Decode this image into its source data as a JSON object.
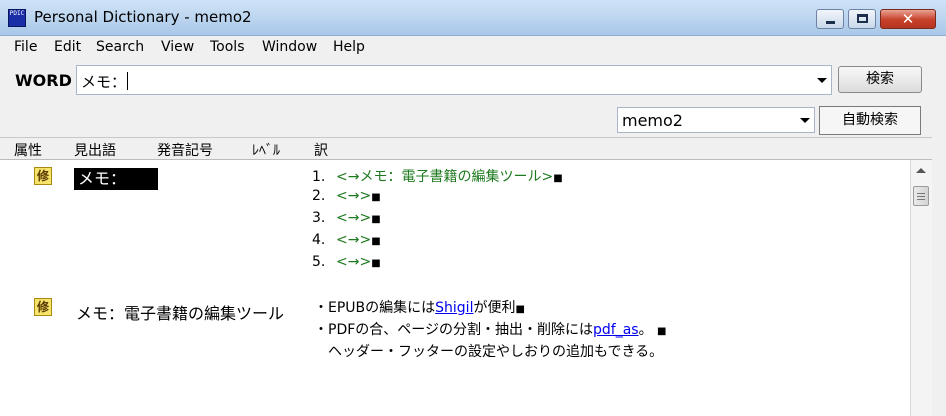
{
  "window": {
    "title": "Personal Dictionary - memo2",
    "app_icon_text": "PDIC"
  },
  "menu": [
    "File",
    "Edit",
    "Search",
    "View",
    "Tools",
    "Window",
    "Help"
  ],
  "search": {
    "label": "WORD",
    "value": "メモ：",
    "button": "検索"
  },
  "dictionary": {
    "selected": "memo2",
    "auto_search_button": "自動検索"
  },
  "columns": [
    "属性",
    "見出語",
    "発音記号",
    "ﾚﾍﾞﾙ",
    "訳"
  ],
  "entries": [
    {
      "attribute": "修",
      "headword": "メモ：",
      "translations": [
        {
          "num": "1.",
          "text": "<→メモ：電子書籍の編集ツール>",
          "end": "■"
        },
        {
          "num": "2.",
          "text": "<→>",
          "end": "■"
        },
        {
          "num": "3.",
          "text": "<→>",
          "end": "■"
        },
        {
          "num": "4.",
          "text": "<→>",
          "end": "■"
        },
        {
          "num": "5.",
          "text": "<→>",
          "end": "■"
        }
      ]
    },
    {
      "attribute": "修",
      "headword": "メモ：電子書籍の編集ツール",
      "lines": {
        "l1_pre": "・EPUBの編集には",
        "l1_link": "Shigil",
        "l1_post": "が便利",
        "l1_end": "■",
        "l2_pre": "・PDFの合、ページの分割・抽出・削除には",
        "l2_link": "pdf_as",
        "l2_post": "。",
        "l2_end": "■",
        "l3": "ヘッダー・フッターの設定やしおりの追加もできる。"
      }
    }
  ]
}
